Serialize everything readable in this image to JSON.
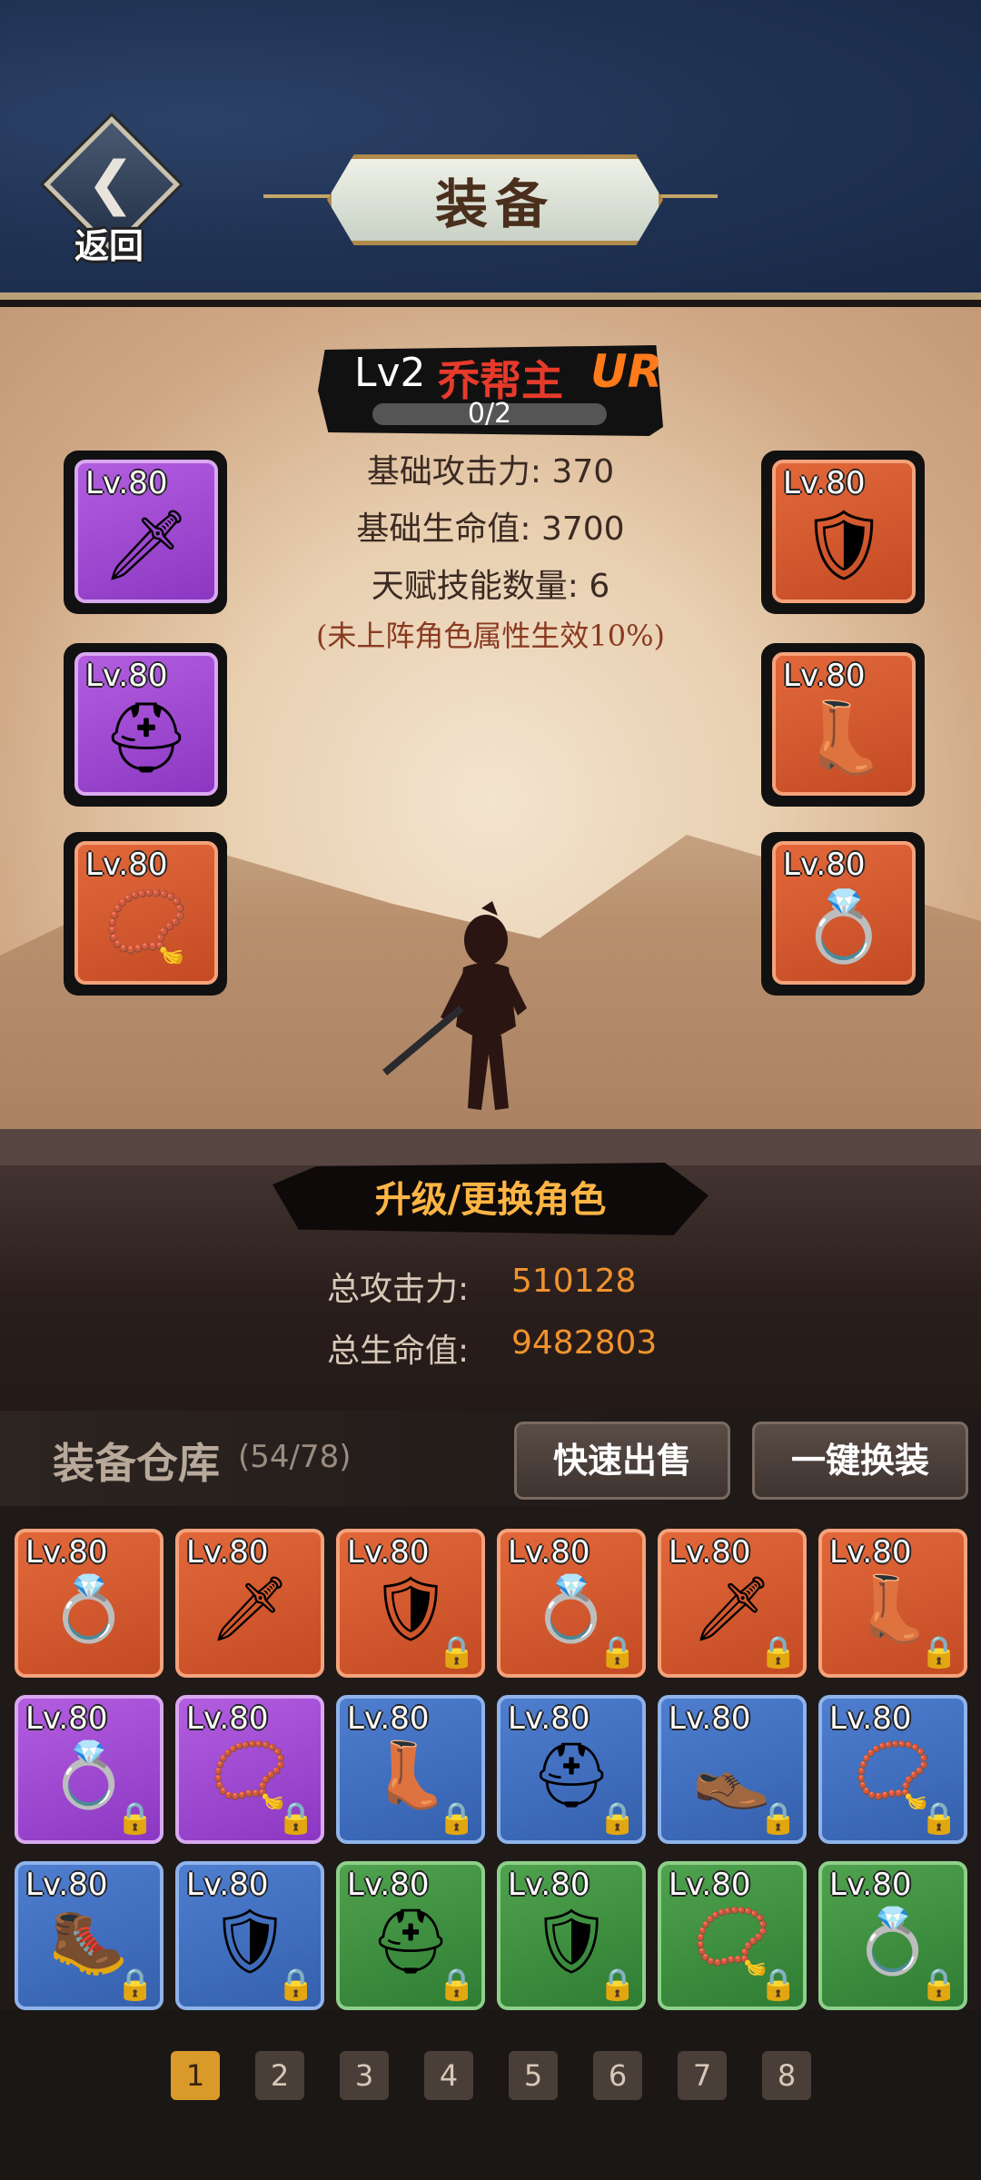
{
  "header": {
    "back_label": "返回",
    "title": "装备"
  },
  "character": {
    "level": "Lv2",
    "name": "乔帮主",
    "rarity": "UR",
    "progress_text": "0/2",
    "progress": 0,
    "stats": [
      {
        "label": "基础攻击力: 370"
      },
      {
        "label": "基础生命值: 3700"
      },
      {
        "label": "天赋技能数量: 6"
      }
    ],
    "note": "(未上阵角色属性生效10%)"
  },
  "equipped": [
    {
      "level": "Lv.80",
      "icon": "sword",
      "glyph": "🗡",
      "rarity": "purple"
    },
    {
      "level": "Lv.80",
      "icon": "helmet",
      "glyph": "⛑",
      "rarity": "purple"
    },
    {
      "level": "Lv.80",
      "icon": "necklace",
      "glyph": "📿",
      "rarity": "orange"
    },
    {
      "level": "Lv.80",
      "icon": "armor",
      "glyph": "🛡",
      "rarity": "orange"
    },
    {
      "level": "Lv.80",
      "icon": "boots",
      "glyph": "👢",
      "rarity": "orange"
    },
    {
      "level": "Lv.80",
      "icon": "ring",
      "glyph": "💍",
      "rarity": "orange"
    }
  ],
  "upgrade_button": "升级/更换角色",
  "totals": {
    "attack_label": "总攻击力:",
    "attack_value": "510128",
    "hp_label": "总生命值:",
    "hp_value": "9482803"
  },
  "warehouse": {
    "title": "装备仓库",
    "count": "(54/78)",
    "quick_sell": "快速出售",
    "one_key_equip": "一键换装",
    "items": [
      {
        "level": "Lv.80",
        "icon": "ring",
        "glyph": "💍",
        "rarity": "orange",
        "locked": false
      },
      {
        "level": "Lv.80",
        "icon": "dagger",
        "glyph": "🗡",
        "rarity": "orange",
        "locked": false
      },
      {
        "level": "Lv.80",
        "icon": "armor",
        "glyph": "🛡",
        "rarity": "orange",
        "locked": true
      },
      {
        "level": "Lv.80",
        "icon": "ring",
        "glyph": "💍",
        "rarity": "orange",
        "locked": true
      },
      {
        "level": "Lv.80",
        "icon": "sword",
        "glyph": "🗡",
        "rarity": "orange",
        "locked": true
      },
      {
        "level": "Lv.80",
        "icon": "boots",
        "glyph": "👢",
        "rarity": "orange",
        "locked": true
      },
      {
        "level": "Lv.80",
        "icon": "ring",
        "glyph": "💍",
        "rarity": "purple",
        "locked": true
      },
      {
        "level": "Lv.80",
        "icon": "necklace",
        "glyph": "📿",
        "rarity": "purple",
        "locked": true
      },
      {
        "level": "Lv.80",
        "icon": "boots",
        "glyph": "👢",
        "rarity": "blue",
        "locked": true
      },
      {
        "level": "Lv.80",
        "icon": "helmet",
        "glyph": "⛑",
        "rarity": "blue",
        "locked": true
      },
      {
        "level": "Lv.80",
        "icon": "boots",
        "glyph": "👞",
        "rarity": "blue",
        "locked": true
      },
      {
        "level": "Lv.80",
        "icon": "necklace",
        "glyph": "📿",
        "rarity": "blue",
        "locked": true
      },
      {
        "level": "Lv.80",
        "icon": "boots",
        "glyph": "🥾",
        "rarity": "blue",
        "locked": true
      },
      {
        "level": "Lv.80",
        "icon": "armor",
        "glyph": "🛡",
        "rarity": "blue",
        "locked": true
      },
      {
        "level": "Lv.80",
        "icon": "helmet",
        "glyph": "⛑",
        "rarity": "green",
        "locked": true
      },
      {
        "level": "Lv.80",
        "icon": "armor",
        "glyph": "🛡",
        "rarity": "green",
        "locked": true
      },
      {
        "level": "Lv.80",
        "icon": "necklace",
        "glyph": "📿",
        "rarity": "green",
        "locked": true
      },
      {
        "level": "Lv.80",
        "icon": "ring",
        "glyph": "💍",
        "rarity": "green",
        "locked": true
      }
    ]
  },
  "pagination": {
    "pages": [
      "1",
      "2",
      "3",
      "4",
      "5",
      "6",
      "7",
      "8"
    ],
    "current": "1"
  },
  "colors": {
    "header_bg": "#1f3152",
    "accent_orange": "#f0932e",
    "name_red": "#e63a2b",
    "active_page": "#d99a2a"
  }
}
